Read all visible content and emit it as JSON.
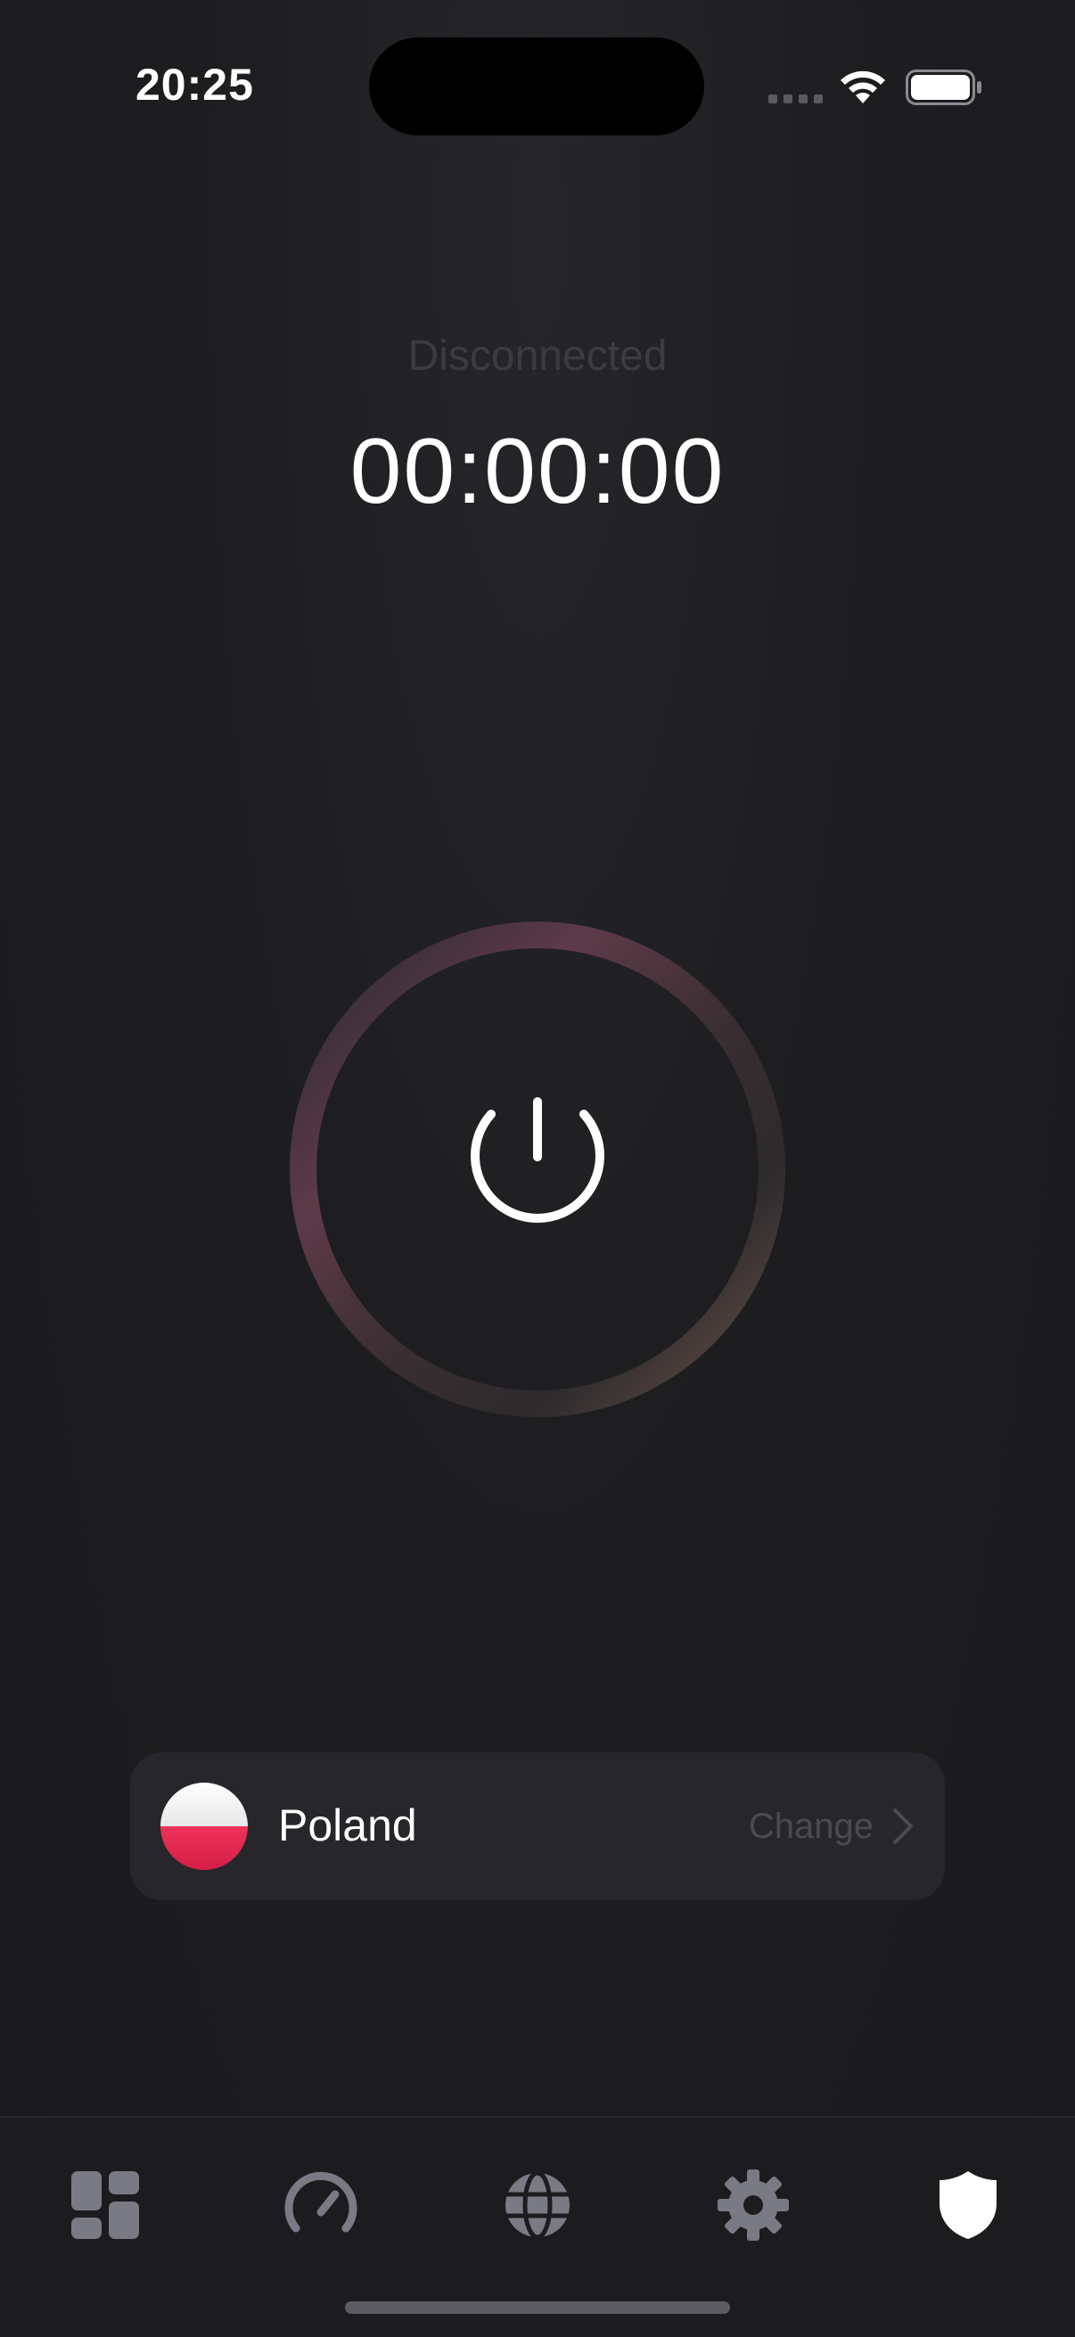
{
  "status_bar": {
    "time": "20:25"
  },
  "connection": {
    "status": "Disconnected",
    "timer": "00:00:00"
  },
  "location": {
    "country": "Poland",
    "change_label": "Change"
  },
  "tabs": [
    {
      "icon": "dashboard-icon"
    },
    {
      "icon": "speedometer-icon"
    },
    {
      "icon": "globe-icon"
    },
    {
      "icon": "gear-icon"
    },
    {
      "icon": "shield-icon",
      "active": true
    }
  ],
  "colors": {
    "background": "#1b1b1e",
    "card": "#27272b",
    "ring_start": "#5e3a48",
    "ring_end": "#6b5148",
    "tab_inactive": "#7a7a84",
    "tab_active": "#ffffff",
    "flag_red": "#e8284f"
  }
}
